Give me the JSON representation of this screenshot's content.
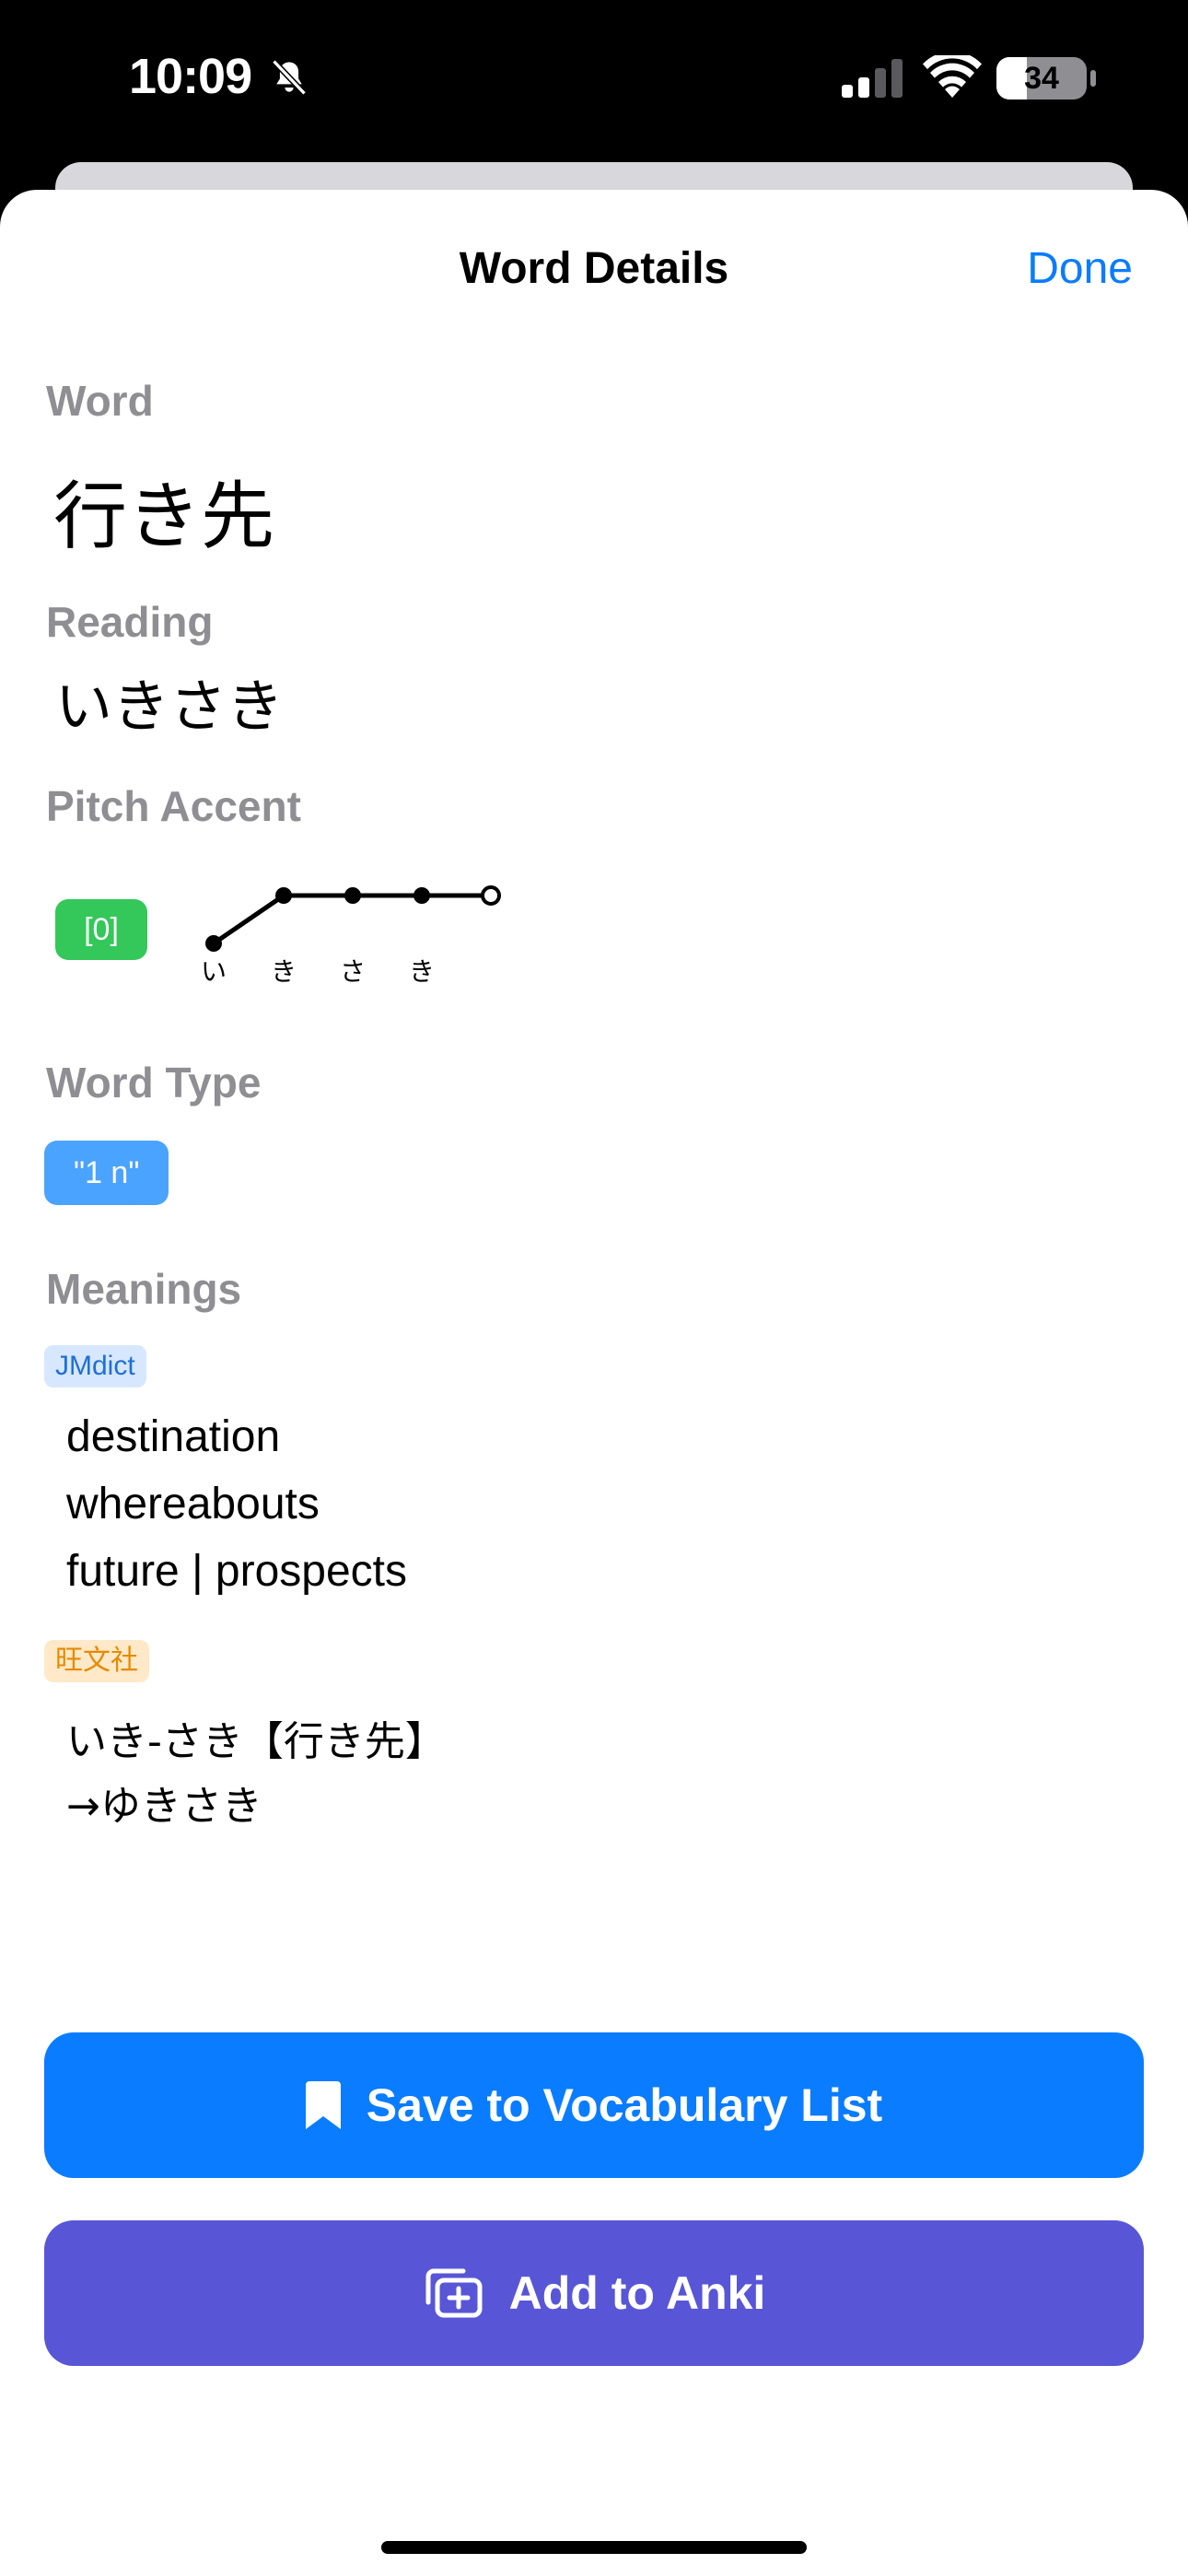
{
  "status_bar": {
    "time": "10:09",
    "battery": "34"
  },
  "nav": {
    "title": "Word Details",
    "done_label": "Done"
  },
  "word": {
    "label": "Word",
    "value": "行き先"
  },
  "reading": {
    "label": "Reading",
    "value": "いきさき"
  },
  "pitch_accent": {
    "label": "Pitch Accent",
    "badge": "[0]",
    "kana": [
      "い",
      "き",
      "さ",
      "き"
    ],
    "pattern": "heiban"
  },
  "word_type": {
    "label": "Word Type",
    "tag": "\"1 n\""
  },
  "meanings": {
    "label": "Meanings",
    "sources": [
      {
        "name": "JMdict",
        "entries": [
          "destination",
          "whereabouts",
          "future | prospects"
        ]
      },
      {
        "name": "旺文社",
        "entries": [
          "いき-さき【行き先】",
          "→ゆきさき"
        ]
      }
    ]
  },
  "actions": {
    "save_label": "Save to Vocabulary List",
    "anki_label": "Add to Anki"
  },
  "colors": {
    "accent_blue": "#0a7cff",
    "anki_purple": "#5856d6",
    "pitch_green": "#34c759",
    "tag_blue": "#4aa3ff",
    "label_gray": "#8e8e93"
  },
  "icons": [
    "bell-slash-icon",
    "cellular-signal-icon",
    "wifi-icon",
    "battery-icon",
    "bookmark-icon",
    "add-card-icon"
  ]
}
